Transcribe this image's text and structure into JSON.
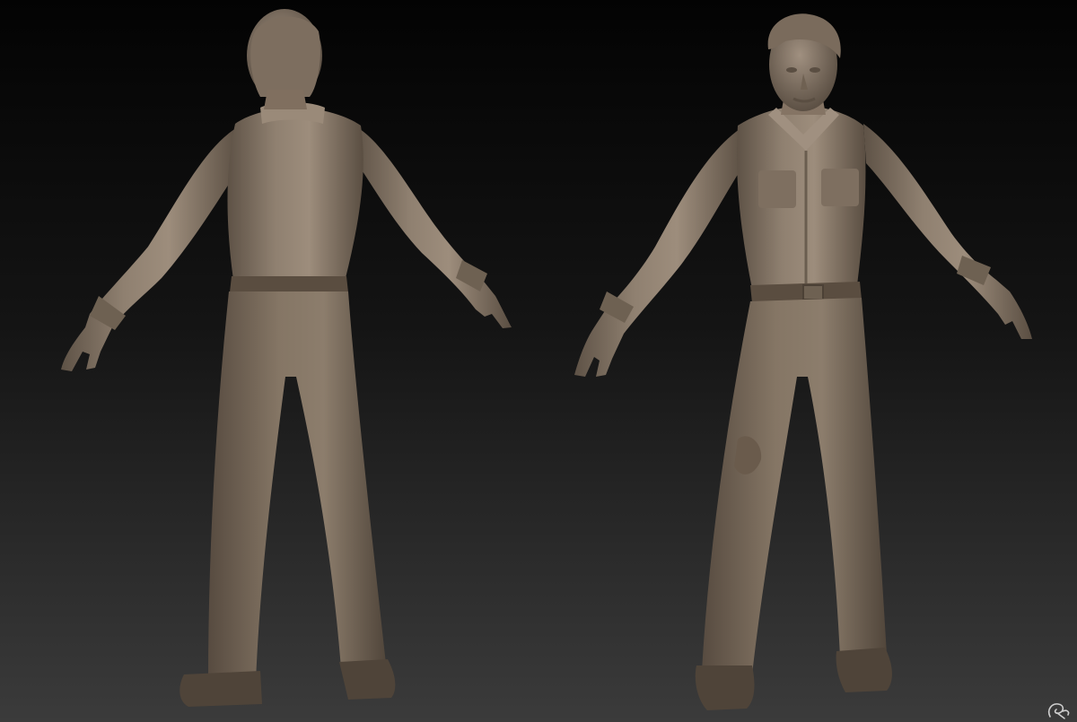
{
  "scene": {
    "background_top": "#050505",
    "background_bottom": "#3a3a3a",
    "clay_color": "#8a7a6a",
    "clay_shadow": "#4a4036",
    "clay_highlight": "#a89886"
  },
  "views": [
    {
      "name": "back-view"
    },
    {
      "name": "front-view"
    }
  ],
  "signature": {
    "icon": "artist-signature-icon"
  }
}
